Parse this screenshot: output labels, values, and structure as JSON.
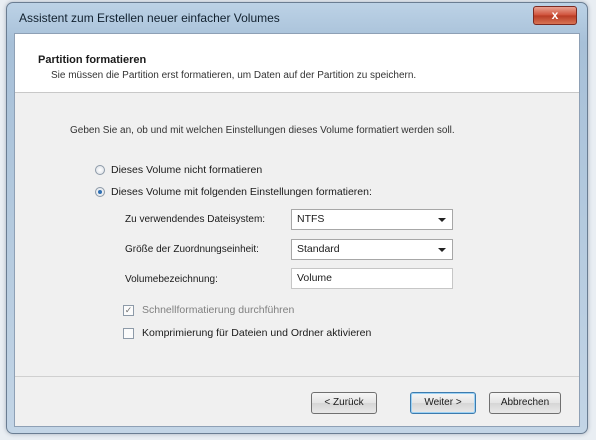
{
  "window": {
    "title": "Assistent zum Erstellen neuer einfacher Volumes",
    "close_label": "x"
  },
  "header": {
    "title": "Partition formatieren",
    "subtitle": "Sie müssen die Partition erst formatieren, um Daten auf der Partition zu speichern."
  },
  "instruction": "Geben Sie an, ob und mit welchen Einstellungen dieses Volume formatiert werden soll.",
  "options": {
    "no_format_label": "Dieses Volume nicht formatieren",
    "format_label": "Dieses Volume mit folgenden Einstellungen formatieren:",
    "selected": "format"
  },
  "settings": {
    "filesystem_label": "Zu verwendendes Dateisystem:",
    "filesystem_value": "NTFS",
    "allocation_label": "Größe der Zuordnungseinheit:",
    "allocation_value": "Standard",
    "volume_label_label": "Volumebezeichnung:",
    "volume_label_value": "Volume",
    "quick_format_label": "Schnellformatierung durchführen",
    "quick_format_checked": true,
    "compression_label": "Komprimierung für Dateien und Ordner aktivieren",
    "compression_checked": false
  },
  "buttons": {
    "back": "< Zurück",
    "next": "Weiter >",
    "cancel": "Abbrechen"
  }
}
